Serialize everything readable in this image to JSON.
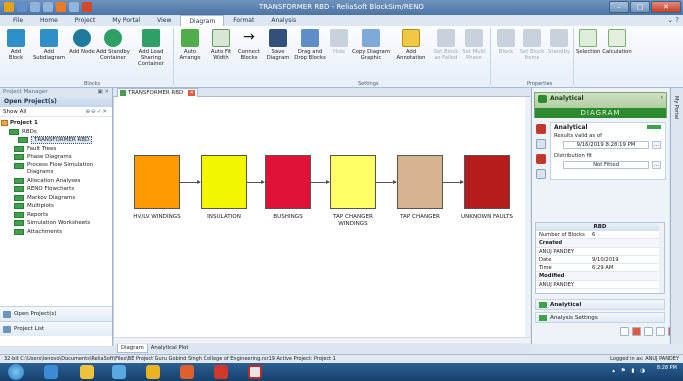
{
  "window": {
    "title": "TRANSFORMER RBD - ReliaSoft BlockSim/RENO"
  },
  "menu": {
    "tabs": [
      "File",
      "Home",
      "Project",
      "My Portal",
      "View",
      "Diagram",
      "Format",
      "Analysis"
    ],
    "active": "Diagram"
  },
  "ribbon": {
    "buttons": [
      "Add Block",
      "Add Subdiagram",
      "Add Node",
      "Add Standby Container",
      "Add Load Sharing Container",
      "Auto Arrange",
      "Auto Fit Width",
      "Connect Blocks",
      "Save Diagram",
      "Drag and Drop Blocks",
      "Hide",
      "Copy Diagram Graphic",
      "Add Annotation",
      "Set Block as Failed",
      "Set Multi Phase",
      "Block",
      "Set Block Items",
      "Standby",
      "Selection",
      "Calculation"
    ],
    "groups": [
      "Blocks",
      "Settings",
      "Properties"
    ]
  },
  "left_panel": {
    "header": "Project Manager",
    "title": "Open Project(s)",
    "filter": "Show All",
    "project": "Project 1",
    "tree": [
      "RBDs",
      "TRANSFORMER RBD",
      "Fault Trees",
      "Phase Diagrams",
      "Process Flow Simulation Diagrams",
      "Allocation Analyses",
      "RENO Flowcharts",
      "Markov Diagrams",
      "Multiplots",
      "Reports",
      "Simulation Worksheets",
      "Attachments"
    ],
    "bottom": [
      "Open Project(s)",
      "Project List"
    ]
  },
  "document": {
    "tab": "TRANSFORMER RBD",
    "bottom_tabs": [
      "Diagram",
      "Analytical Plot"
    ],
    "blocks": [
      {
        "label": "HV/LV WINDINGS",
        "color": "#ff9a00"
      },
      {
        "label": "INSULATION",
        "color": "#f2f700"
      },
      {
        "label": "BUSHINGS",
        "color": "#e01238"
      },
      {
        "label": "TAP CHANGER WINDINGS",
        "color": "#ffff66"
      },
      {
        "label": "TAP CHANGER",
        "color": "#d5b48f"
      },
      {
        "label": "UNKNOWN FAULTS",
        "color": "#b61c1c"
      }
    ]
  },
  "right_panel": {
    "header": "Analytical",
    "band": "DIAGRAM",
    "props_title": "Analytical",
    "results_valid_label": "Results valid as of",
    "results_valid_value": "9/16/2019 8:28:19 PM",
    "distribution_label": "Distribution fit",
    "distribution_value": "Not Fitted",
    "table_title": "RBD",
    "table_rows": [
      {
        "k": "Number of Blocks",
        "v": "6",
        "sec": false
      },
      {
        "k": "Created",
        "v": "",
        "sec": true
      },
      {
        "k": "ANUJ PANDEY",
        "v": "",
        "sec": false
      },
      {
        "k": "Date",
        "v": "9/10/2019",
        "sec": false
      },
      {
        "k": "Time",
        "v": "6:29 AM",
        "sec": false
      },
      {
        "k": "Modified",
        "v": "",
        "sec": true
      },
      {
        "k": "ANUJ PANDEY",
        "v": "",
        "sec": false
      }
    ],
    "section1": "Analytical",
    "section2": "Analysis Settings"
  },
  "side_tab": "My Portal",
  "status": {
    "left": "32-bit  C:\\Users\\lenovo\\Documents\\ReliaSoft\\Files\\BE Project Guru Gobind Singh College of Engineering.rsr19  Active Project: Project 1",
    "right": "Logged in as: ANUJ PANDEY"
  },
  "taskbar": {
    "time": "8:28 PM"
  }
}
